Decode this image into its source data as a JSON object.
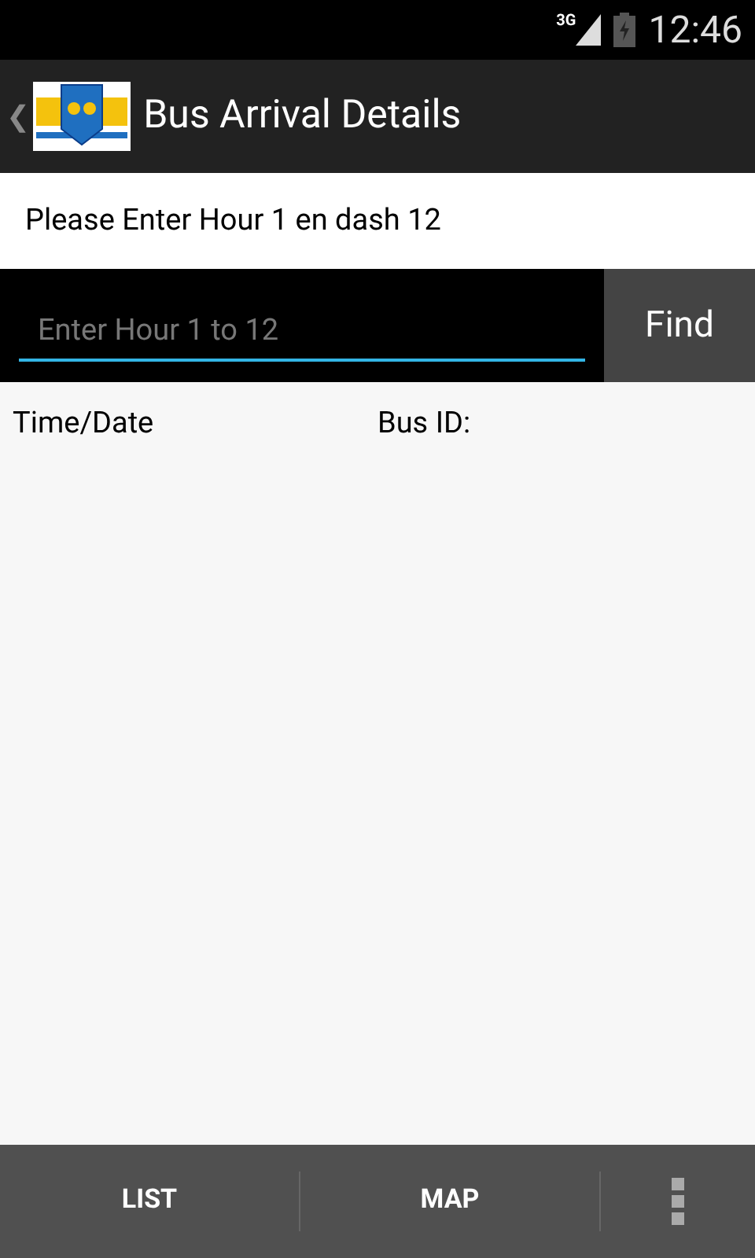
{
  "status_bar": {
    "network": "3G",
    "time": "12:46"
  },
  "action_bar": {
    "back": "❮",
    "title": "Bus Arrival Details"
  },
  "prompt": "Please Enter Hour 1 en dash 12",
  "search": {
    "placeholder": "Enter Hour 1 to 12",
    "button": "Find"
  },
  "table": {
    "columns": [
      "Time/Date",
      "Bus ID:"
    ]
  },
  "bottom_bar": {
    "buttons": [
      "LIST",
      "MAP"
    ]
  }
}
